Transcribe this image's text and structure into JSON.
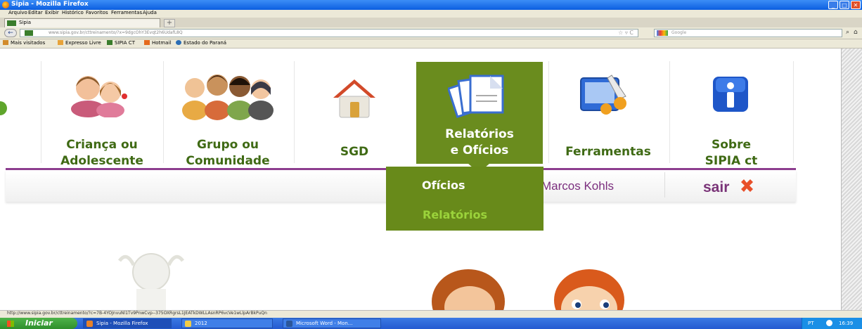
{
  "window": {
    "title": "Sipia - Mozilla Firefox",
    "buttons": [
      "_",
      "□",
      "✕"
    ]
  },
  "menu": [
    "Arquivo",
    "Editar",
    "Exibir",
    "Histórico",
    "Favoritos",
    "Ferramentas",
    "Ajuda"
  ],
  "tab": {
    "label": "Sipia",
    "new_tab": "+"
  },
  "nav": {
    "back": "←",
    "url_prefix": "www.sipia.gov.br",
    "url": "www.sipia.gov.br/cttreinamento/?x=9dgcOhY3Evqt2h6UdafL8Q",
    "url_icons": "☆ ▿ C",
    "search_placeholder": "Google",
    "search_icon": "magnifier-icon",
    "home_icon": "home-icon"
  },
  "bookmarks": [
    {
      "label": "Mais visitados",
      "color": "#d28b2a"
    },
    {
      "label": "Expresso Livre",
      "color": "#e7a33a"
    },
    {
      "label": "SIPIA CT",
      "color": "#3a7d2c"
    },
    {
      "label": "Hotmail",
      "color": "#e56a1d"
    },
    {
      "label": "Estado do Paraná",
      "color": "#2b6db5"
    }
  ],
  "site_nav": {
    "items": [
      {
        "label_line1": "Criança ou",
        "label_line2": "Adolescente",
        "icon": "children-icon"
      },
      {
        "label_line1": "Grupo ou",
        "label_line2": "Comunidade",
        "icon": "group-icon"
      },
      {
        "label_line1": "SGD",
        "label_line2": "",
        "icon": "house-icon"
      },
      {
        "label_line1": "Relatórios",
        "label_line2": "e Ofícios",
        "icon": "documents-icon",
        "active": true
      },
      {
        "label_line1": "Ferramentas",
        "label_line2": "",
        "icon": "tools-icon"
      },
      {
        "label_line1": "Sobre",
        "label_line2": "SIPIA ct",
        "icon": "info-icon"
      }
    ],
    "accent": "#6a8c1e",
    "text_color": "#3f6a14"
  },
  "dropdown": {
    "items": [
      "Ofícios",
      "Relatórios"
    ]
  },
  "user": {
    "name": "Marcos Kohls",
    "logout": "sair",
    "logout_icon": "close-x-icon"
  },
  "status_url": "http://www.sipia.gov.br/cttreinamento/?c=7B-4YOJnvuNl1Tv9PnwCvp--375OXRgrsL1JEATkDWLLAsnRP6vcVe1wLlpArBkPuQn",
  "taskbar": {
    "start": "Iniciar",
    "items": [
      "Sipia - Mozilla Firefox",
      "2012",
      "Microsoft Word - Mon..."
    ],
    "lang": "PT",
    "time": "16:39"
  }
}
